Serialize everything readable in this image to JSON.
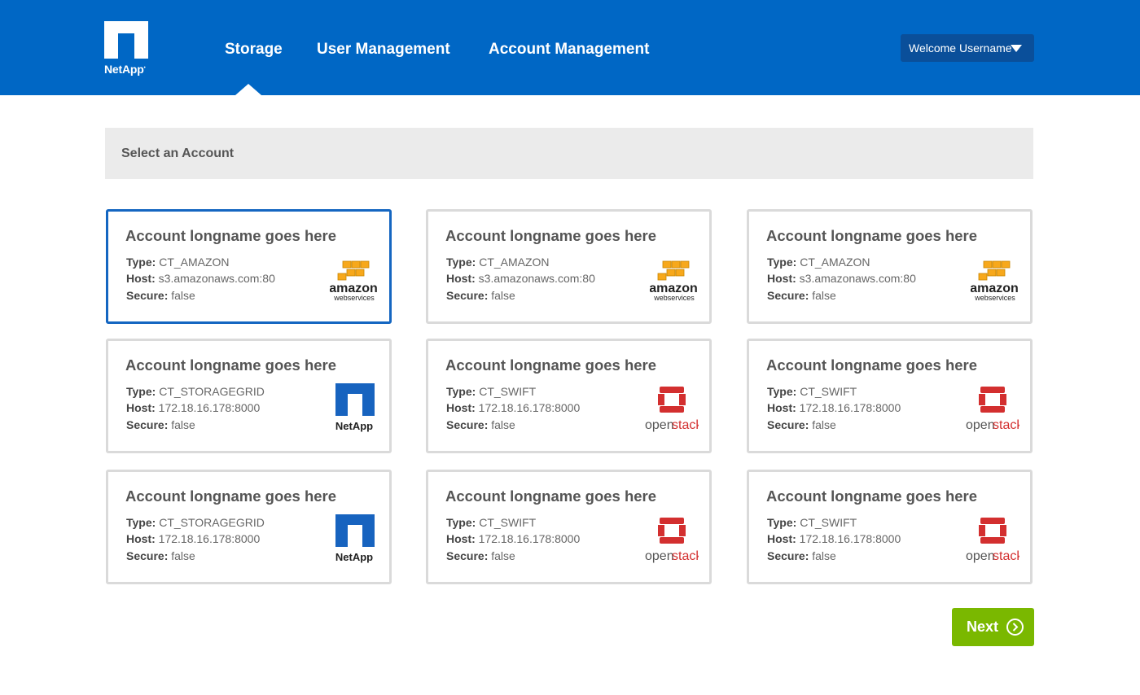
{
  "header": {
    "brand": "NetApp",
    "nav": [
      "Storage",
      "User Management",
      "Account Management"
    ],
    "active_nav": "Storage",
    "user_menu": "Welcome Username"
  },
  "section_title": "Select an Account",
  "field_labels": {
    "type": "Type:",
    "host": "Host:",
    "secure": "Secure:"
  },
  "accounts": [
    {
      "name": "Account longname goes here",
      "type": "CT_AMAZON",
      "host": "s3.amazonaws.com:80",
      "secure": "false",
      "logo": "amazon-web-services",
      "selected": true
    },
    {
      "name": "Account longname goes here",
      "type": "CT_AMAZON",
      "host": "s3.amazonaws.com:80",
      "secure": "false",
      "logo": "amazon-web-services",
      "selected": false
    },
    {
      "name": "Account longname goes here",
      "type": "CT_AMAZON",
      "host": "s3.amazonaws.com:80",
      "secure": "false",
      "logo": "amazon-web-services",
      "selected": false
    },
    {
      "name": "Account longname goes here",
      "type": "CT_STORAGEGRID",
      "host": "172.18.16.178:8000",
      "secure": "false",
      "logo": "netapp",
      "selected": false
    },
    {
      "name": "Account longname goes here",
      "type": "CT_SWIFT",
      "host": "172.18.16.178:8000",
      "secure": "false",
      "logo": "openstack",
      "selected": false
    },
    {
      "name": "Account longname goes here",
      "type": "CT_SWIFT",
      "host": "172.18.16.178:8000",
      "secure": "false",
      "logo": "openstack",
      "selected": false
    },
    {
      "name": "Account longname goes here",
      "type": "CT_STORAGEGRID",
      "host": "172.18.16.178:8000",
      "secure": "false",
      "logo": "netapp",
      "selected": false
    },
    {
      "name": "Account longname goes here",
      "type": "CT_SWIFT",
      "host": "172.18.16.178:8000",
      "secure": "false",
      "logo": "openstack",
      "selected": false
    },
    {
      "name": "Account longname goes here",
      "type": "CT_SWIFT",
      "host": "172.18.16.178:8000",
      "secure": "false",
      "logo": "openstack",
      "selected": false
    }
  ],
  "logo_text": {
    "amazon": "amazon",
    "amazon_sub": "webservices",
    "netapp": "NetApp",
    "openstack_a": "open",
    "openstack_b": "stack"
  },
  "next_label": "Next",
  "colors": {
    "header": "#0067c5",
    "selected_border": "#1466c1",
    "next": "#7ab800",
    "openstack_red": "#d32f2f",
    "aws_orange": "#f7a81b"
  }
}
